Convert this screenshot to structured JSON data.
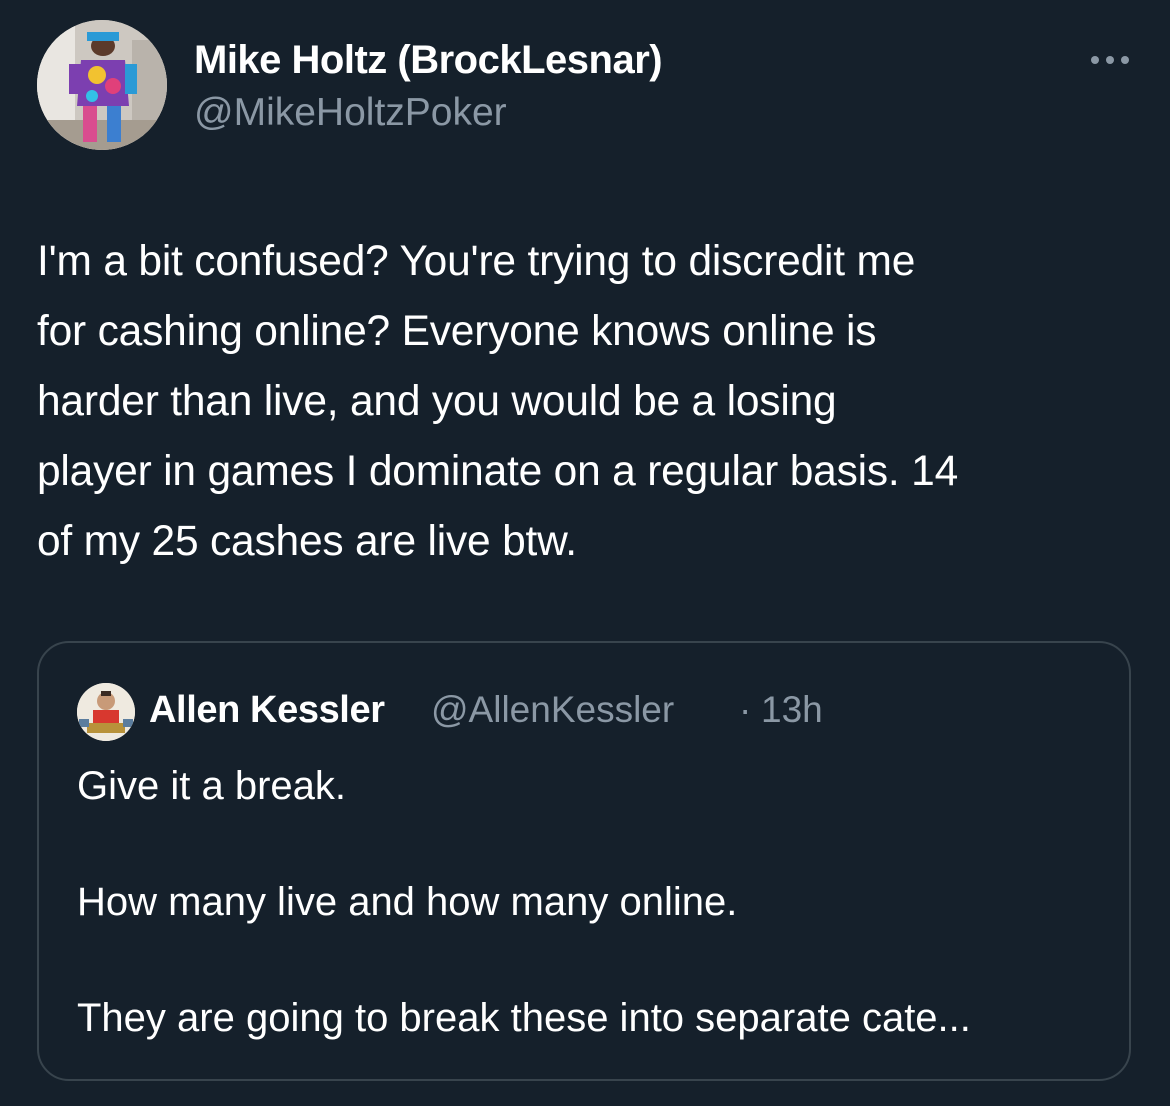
{
  "tweet": {
    "author": {
      "display_name": "Mike Holtz (BrockLesnar)",
      "handle": "@MikeHoltzPoker",
      "avatar_icon": "user-avatar-photo"
    },
    "more_icon": "more-horizontal-icon",
    "text": "I'm a bit confused? You're trying to discredit me\nfor cashing online? Everyone knows online is\nharder than live, and you would be a losing\nplayer in games I dominate on a regular basis. 14\nof my 25 cashes are live btw."
  },
  "quote": {
    "author": {
      "display_name": "Allen Kessler",
      "handle": "@AllenKessler",
      "separator": "·",
      "time": "13h",
      "avatar_icon": "user-avatar-photo"
    },
    "paragraphs": [
      "Give it a break.",
      "How many live and how many online.",
      "They are going to break these into separate cate..."
    ]
  },
  "colors": {
    "background": "#15202b",
    "text_primary": "#ffffff",
    "text_secondary": "#8b98a5",
    "border": "#38444d"
  }
}
